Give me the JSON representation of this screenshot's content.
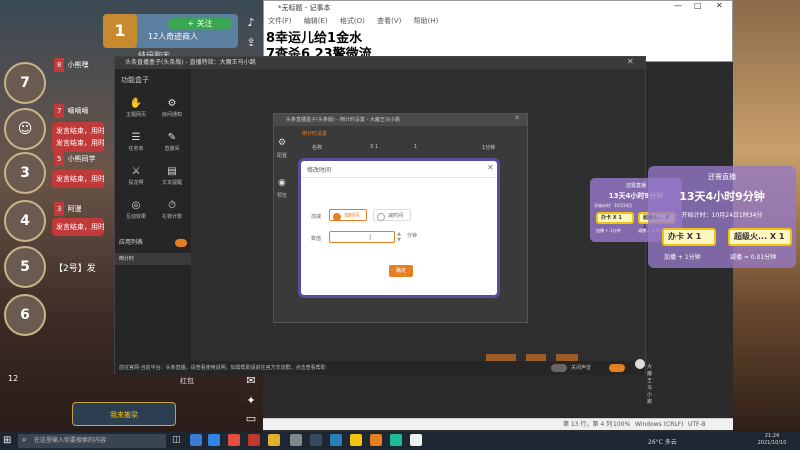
{
  "widget": {
    "follow": "+ 关注",
    "viewers": "12人奇迹商人",
    "caption": "结缘聊天"
  },
  "feed": {
    "users": [
      "小熊嘿",
      "嘀嘀嘀",
      "小熊同学",
      "阿漫"
    ],
    "messages": [
      "发言结束，用时",
      "发言结束，用时",
      "发言结束，用时",
      "发言结束，用时"
    ],
    "team_line": "【2号】发",
    "ranks": [
      "7",
      "5",
      "3",
      "4",
      "6"
    ],
    "bottom_num": "12",
    "bottom_label": "红包",
    "avatar_label": "我来搬梁"
  },
  "notepad": {
    "title": "*无标题 - 记事本",
    "menu": [
      "文件(F)",
      "编辑(E)",
      "格式(O)",
      "查看(V)",
      "帮助(H)"
    ],
    "line1": "8幸运儿给1金水",
    "line2": "7查杀6 23警微流",
    "status": {
      "pos": "第 13 行，第 4 列",
      "zoom": "100%",
      "eol": "Windows (CRLF)",
      "enc": "UTF-8"
    }
  },
  "app": {
    "title": "头条直播盒子(头条版) - 直播特效：大魔王马小跳",
    "side_heading": "功能盒子",
    "tools": [
      {
        "icon": "✋",
        "label": "主题网页"
      },
      {
        "icon": "⚙",
        "label": "房间通知"
      },
      {
        "icon": "☰",
        "label": "任务单"
      },
      {
        "icon": "✎",
        "label": "直播间"
      },
      {
        "icon": "⚔",
        "label": "投龙啊"
      },
      {
        "icon": "▤",
        "label": "文本提醒"
      },
      {
        "icon": "◎",
        "label": "互动效果"
      },
      {
        "icon": "⏱",
        "label": "礼物计数"
      }
    ],
    "playlist_label": "应用列表",
    "playlist_item": "倒计时",
    "bottom_text": "前往官网·当前平台：头条直播，请查看使用说明，如需帮助请前往官方交流群，点击查看帮助",
    "bottom_right_label": "关闭声音",
    "user_name": "大魔王马小跳"
  },
  "inner": {
    "title": "头条直播盒子(头条版) - 倒计时设置 - 大魔王马小跳",
    "side_labels": [
      "配置",
      "预览"
    ],
    "sub_title": "倒计时设置",
    "col_headers": [
      "名称",
      "X 1",
      "1",
      "1分钟"
    ]
  },
  "modal": {
    "title": "修改时间",
    "type_label": "加减",
    "opt_add": "加时间",
    "opt_sub": "减时间",
    "amount_label": "数值",
    "value": "",
    "unit": "分钟",
    "ok": "确定"
  },
  "overlay_big": {
    "heading": "还需直播",
    "time": "13天4小时9分钟",
    "end_label": "开始计时：10月24日1时34分",
    "cards": [
      "办卡 X 1",
      "超级火... X 1"
    ],
    "footer": [
      "加播 + 1分钟",
      "减播 = 0.01分钟"
    ]
  },
  "overlay_small": {
    "heading": "还需直播",
    "time": "13天4小时9分钟",
    "sub": "开始计时：10月24日",
    "cards": [
      "办卡 X 1",
      "超级火... X 1"
    ],
    "footer": [
      "加播 + 1分钟",
      "减播 = 0.01分钟"
    ]
  },
  "taskbar": {
    "search": "在这里输入你要搜索的内容",
    "weather": "26°C 多云",
    "time": "21:24",
    "date": "2021/10/10"
  },
  "colors": {
    "accent": "#e67e22",
    "modal_border": "#5b4ba0",
    "overlay": "#9678c8"
  }
}
